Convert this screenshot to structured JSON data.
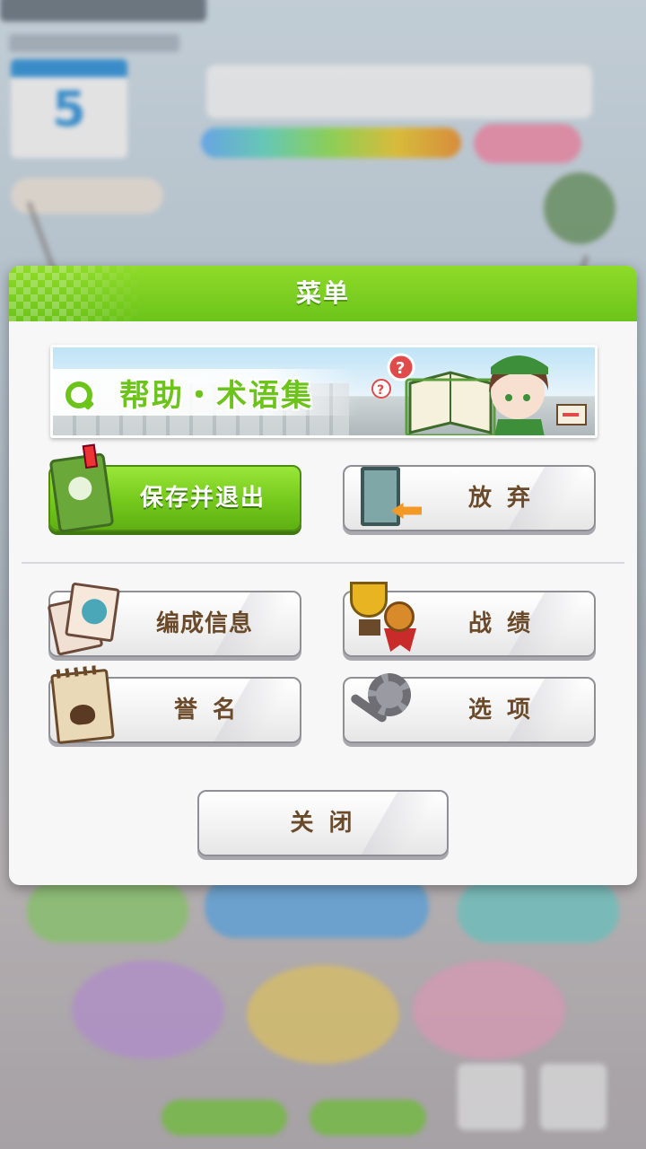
{
  "dialog": {
    "title": "菜单",
    "help_banner": {
      "label": "帮助・术语集"
    },
    "buttons": {
      "save_exit": "保存并退出",
      "give_up": "放 弃",
      "formation_info": "编成信息",
      "record": "战 绩",
      "title_name": "誉 名",
      "options": "选 项",
      "close": "关 闭"
    }
  },
  "background": {
    "calendar_day": "5"
  },
  "colors": {
    "header_green": "#74c91c",
    "label_brown": "#6a4a2a",
    "help_green": "#6cc41a"
  }
}
